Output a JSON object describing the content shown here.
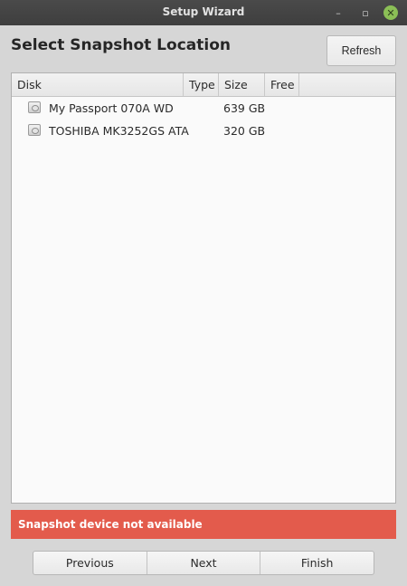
{
  "window": {
    "title": "Setup Wizard",
    "controls": {
      "minimize_glyph": "–",
      "maximize_glyph": "▫",
      "close_glyph": "✕"
    }
  },
  "header": {
    "title": "Select Snapshot Location",
    "refresh_label": "Refresh"
  },
  "table": {
    "columns": [
      "Disk",
      "Type",
      "Size",
      "Free"
    ],
    "rows": [
      {
        "icon": "hard-disk-icon",
        "disk": "My Passport 070A WD",
        "type": "",
        "size": "639 GB",
        "free": ""
      },
      {
        "icon": "hard-disk-icon",
        "disk": "TOSHIBA MK3252GS ATA",
        "type": "",
        "size": "320 GB",
        "free": ""
      }
    ]
  },
  "status": {
    "message": "Snapshot device not available",
    "color": "#e35b4c"
  },
  "footer": {
    "previous_label": "Previous",
    "next_label": "Next",
    "finish_label": "Finish"
  },
  "colors": {
    "titlebar": "#3e3e3e",
    "close_button": "#8bbf56",
    "window_bg": "#d6d6d6"
  }
}
